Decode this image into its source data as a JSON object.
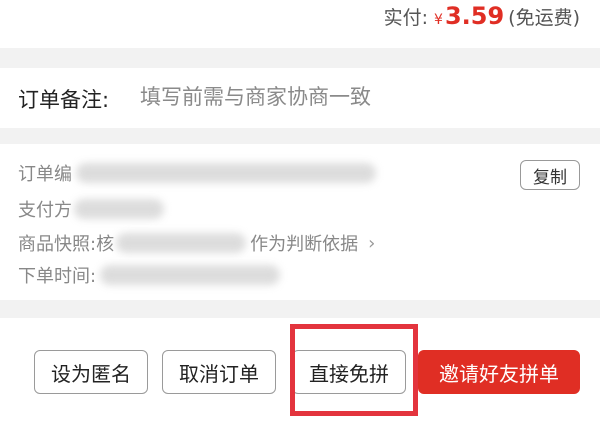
{
  "price": {
    "label": "实付:",
    "currency": "¥",
    "amount": "3.59",
    "note": "(免运费)",
    "accent_color": "#e02e24"
  },
  "remark": {
    "label": "订单备注:",
    "placeholder": "填写前需与商家协商一致",
    "value": ""
  },
  "order_info": {
    "order_no_label": "订单编",
    "payment_label": "支付方",
    "snapshot_label": "商品快照:",
    "snapshot_prefix": "核",
    "snapshot_suffix": "作为判断依据",
    "snapshot_arrow_icon": "chevron-right-icon",
    "order_time_label": "下单时间:",
    "copy_button": "复制"
  },
  "actions": {
    "anonymous": "设为匿名",
    "cancel_order": "取消订单",
    "direct_free": "直接免拼",
    "invite_friends": "邀请好友拼单",
    "highlight_color": "#e3343d"
  }
}
